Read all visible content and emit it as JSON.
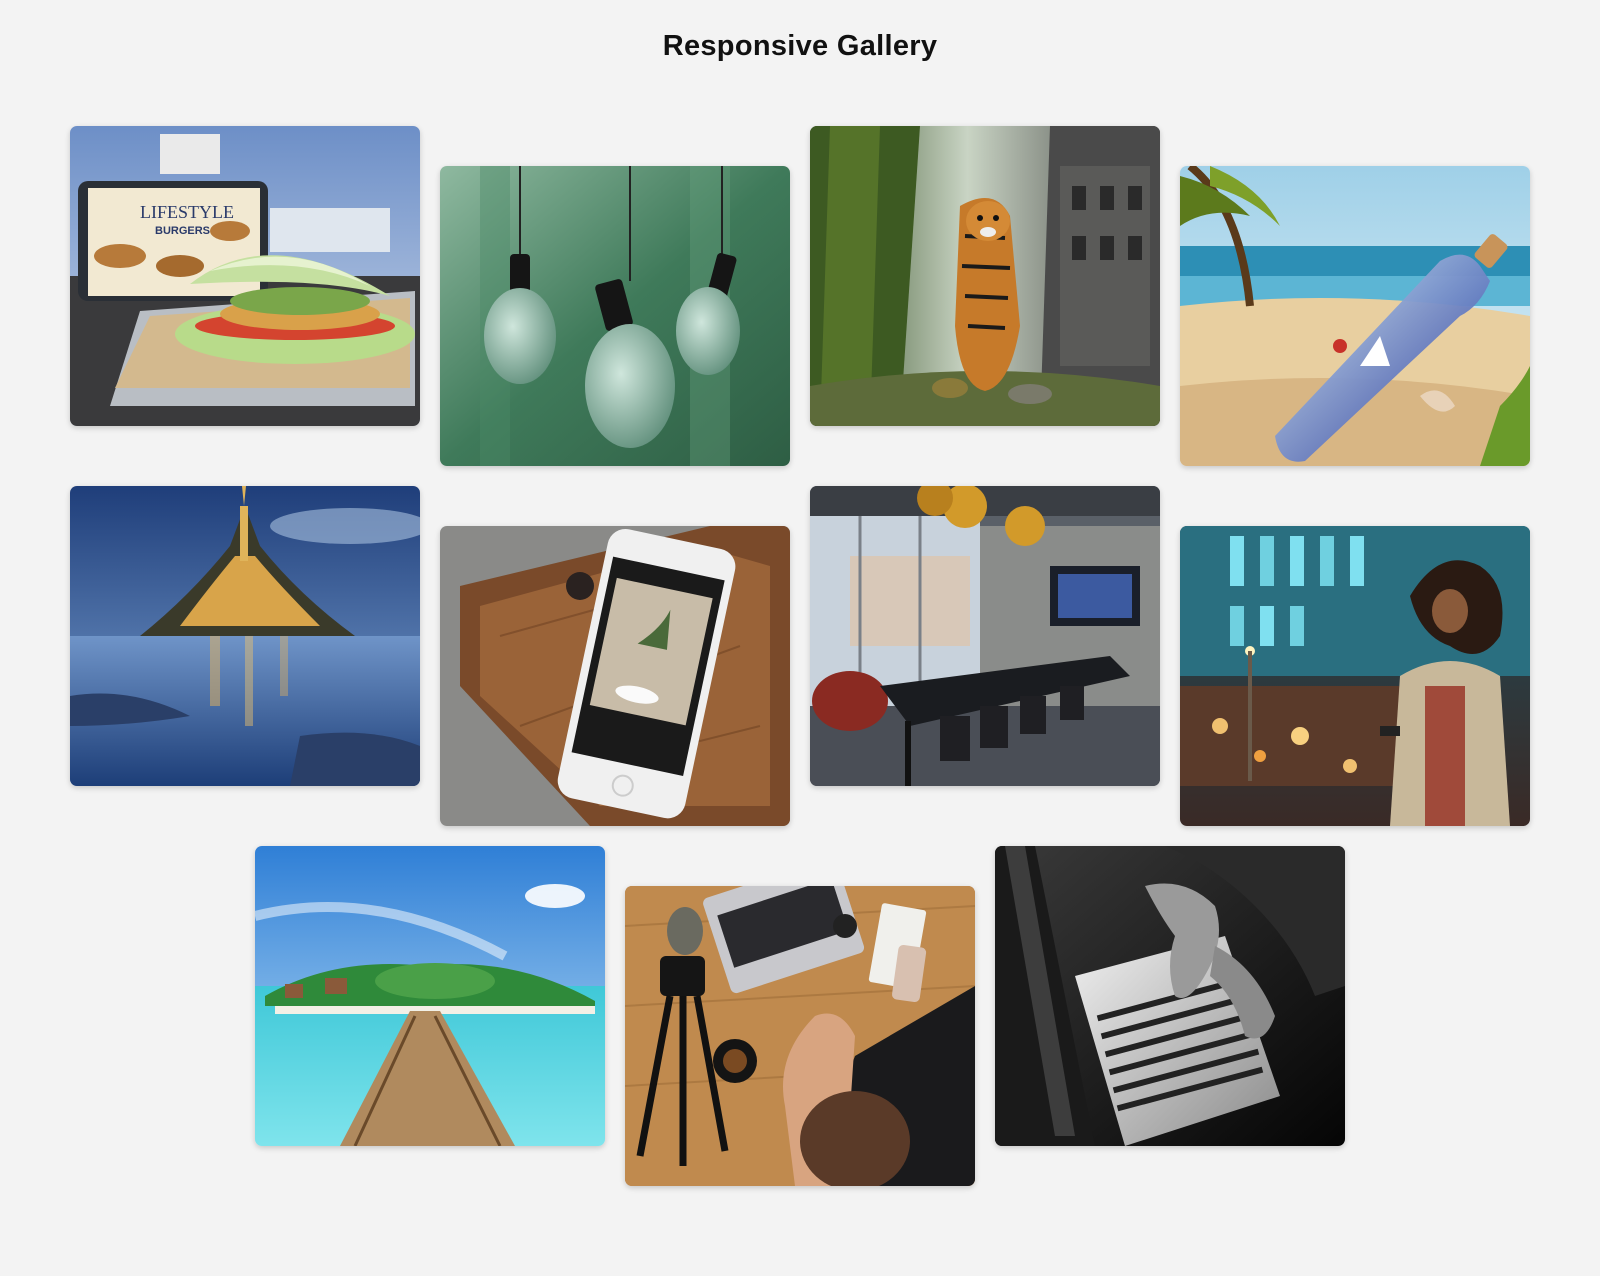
{
  "page": {
    "title": "Responsive Gallery"
  },
  "gallery": {
    "items": [
      {
        "subject": "burger",
        "icon": "burger-photo"
      },
      {
        "subject": "hanging-bulbs",
        "icon": "light-bulbs-photo"
      },
      {
        "subject": "tiger",
        "icon": "tiger-photo"
      },
      {
        "subject": "bottle-beach",
        "icon": "bottle-on-beach-photo"
      },
      {
        "subject": "island-castle",
        "icon": "castle-island-photo"
      },
      {
        "subject": "phone-on-table",
        "icon": "smartphone-photo"
      },
      {
        "subject": "meeting-room",
        "icon": "conference-room-photo"
      },
      {
        "subject": "woman-city-night",
        "icon": "woman-city-photo"
      },
      {
        "subject": "tropical-pier",
        "icon": "tropical-beach-photo"
      },
      {
        "subject": "laptop-desk",
        "icon": "desk-workspace-photo"
      },
      {
        "subject": "laptop-hands-bw",
        "icon": "laptop-typing-photo"
      }
    ]
  },
  "colors": {
    "background": "#f3f3f3",
    "title": "#111111"
  }
}
